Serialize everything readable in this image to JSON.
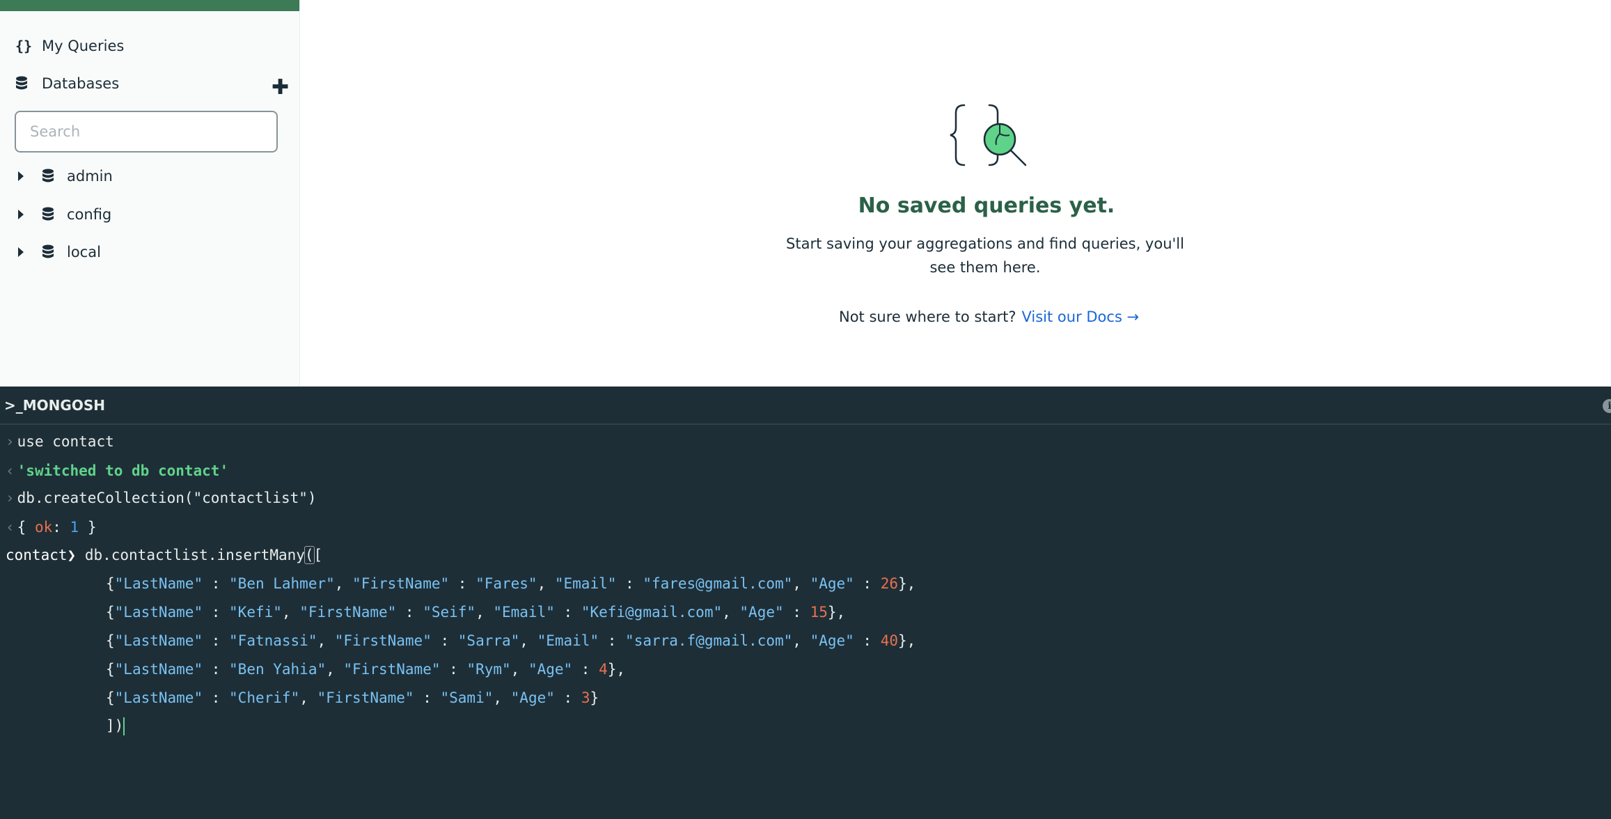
{
  "sidebar": {
    "my_queries": {
      "icon": "curly-braces-icon",
      "label": "My Queries"
    },
    "databases": {
      "icon": "database-icon",
      "label": "Databases",
      "add_icon": "plus-icon"
    },
    "search_placeholder": "Search",
    "db_list": [
      "admin",
      "config",
      "local"
    ]
  },
  "empty_state": {
    "title": "No saved queries yet.",
    "description": "Start saving your aggregations and find queries, you'll see them here.",
    "prompt": "Not sure where to start?",
    "link": "Visit our Docs →"
  },
  "shell": {
    "title": ">_MONGOSH",
    "history": [
      {
        "type": "input",
        "text": "use contact"
      },
      {
        "type": "output",
        "text": "'switched to db contact'"
      },
      {
        "type": "input",
        "text": "db.createCollection(\"contactlist\")"
      },
      {
        "type": "output",
        "key": "ok",
        "value": "1"
      }
    ],
    "prompt": "contact",
    "command_head": "db.contactlist.insertMany",
    "documents": [
      {
        "LastName": "Ben Lahmer",
        "FirstName": "Fares",
        "Email": "fares@gmail.com",
        "Age": "26",
        "suffix": "},"
      },
      {
        "LastName": "Kefi",
        "FirstName": "Seif",
        "Email": "Kefi@gmail.com",
        "Age": "15",
        "suffix": "},"
      },
      {
        "LastName": "Fatnassi",
        "FirstName": "Sarra",
        "Email": "sarra.f@gmail.com",
        "Age": "40",
        "suffix": "},"
      },
      {
        "LastName": "Ben Yahia",
        "FirstName": "Rym",
        "Age": "4",
        "suffix": "},"
      },
      {
        "LastName": "Cherif",
        "FirstName": "Sami",
        "Age": "3",
        "suffix": "}"
      }
    ],
    "closing": "])"
  }
}
